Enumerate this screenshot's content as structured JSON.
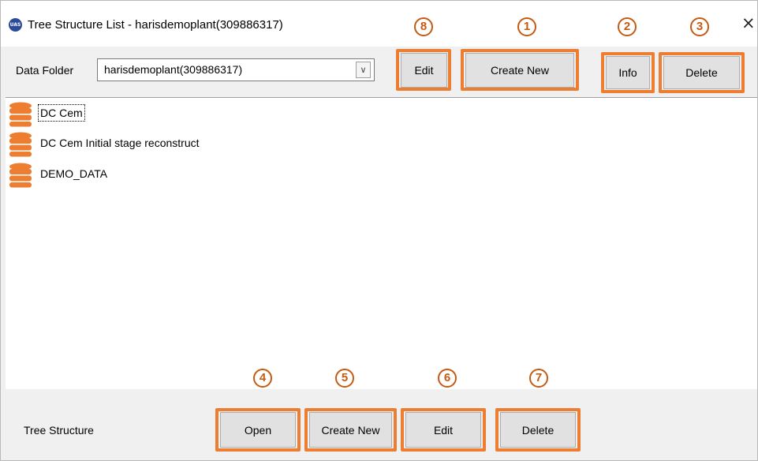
{
  "window": {
    "app_icon_text": "UAS",
    "title": "Tree Structure List - harisdemoplant(309886317)",
    "close_glyph": "×"
  },
  "toolbar": {
    "data_folder_label": "Data Folder",
    "data_folder_value": "harisdemoplant(309886317)",
    "dropdown_glyph": "∨",
    "edit_label": "Edit",
    "create_new_label": "Create New",
    "info_label": "Info",
    "delete_label": "Delete"
  },
  "list": {
    "items": [
      {
        "label": "DC Cem",
        "selected": true
      },
      {
        "label": "DC Cem Initial stage reconstruct",
        "selected": false
      },
      {
        "label": "DEMO_DATA",
        "selected": false
      }
    ]
  },
  "bottom": {
    "tree_structure_label": "Tree Structure",
    "open_label": "Open",
    "create_new_label": "Create New",
    "edit_label": "Edit",
    "delete_label": "Delete"
  },
  "callouts": {
    "n1": "1",
    "n2": "2",
    "n3": "3",
    "n4": "4",
    "n5": "5",
    "n6": "6",
    "n7": "7",
    "n8": "8"
  },
  "colors": {
    "highlight": "#ed7d31",
    "callout": "#c55a11",
    "db_icon": "#ed7d31"
  }
}
